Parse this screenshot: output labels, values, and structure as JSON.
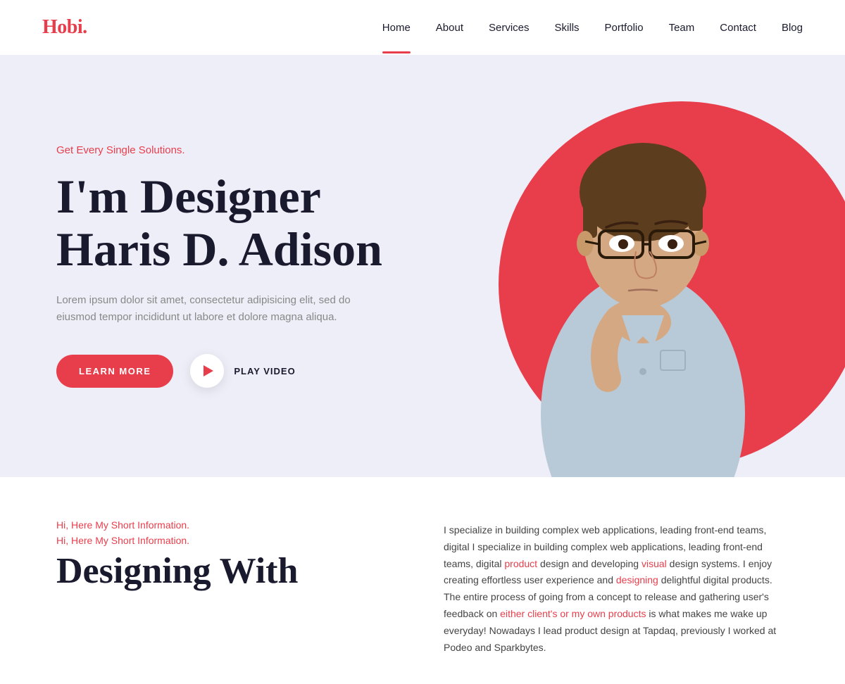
{
  "header": {
    "logo_main": "Hobi",
    "logo_dot": ".",
    "nav": [
      {
        "label": "Home",
        "active": true
      },
      {
        "label": "About",
        "active": false
      },
      {
        "label": "Services",
        "active": false
      },
      {
        "label": "Skills",
        "active": false
      },
      {
        "label": "Portfolio",
        "active": false
      },
      {
        "label": "Team",
        "active": false
      },
      {
        "label": "Contact",
        "active": false
      },
      {
        "label": "Blog",
        "active": false
      }
    ]
  },
  "hero": {
    "tagline": "Get Every Single Solutions.",
    "title_line1": "I'm Designer",
    "title_line2": "Haris D. Adison",
    "description": "Lorem ipsum dolor sit amet, consectetur adipisicing elit, sed do eiusmod tempor incididunt ut labore et dolore magna aliqua.",
    "learn_more_label": "LEARN MORE",
    "play_video_label": "PLAY VIDEO"
  },
  "about": {
    "label1": "Hi, Here My Short Information.",
    "label2": "Hi, Here My Short Information.",
    "heading_line1": "Designing With",
    "body_text": "I specialize in building complex web applications, leading front-end teams, digital I specialize in building complex web applications, leading front-end teams, digital product design and developing visual design systems. I enjoy creating effortless user experience and designing delightful digital products. The entire process of going from a concept to release and gathering user's feedback on either client's or my own products is what makes me wake up everyday! Nowadays I lead product design at Tapdaq, previously I worked at Podeo and Sparkbytes."
  },
  "colors": {
    "accent": "#e83e4c",
    "dark": "#1a1a2e",
    "bg_hero": "#eeeef8"
  }
}
